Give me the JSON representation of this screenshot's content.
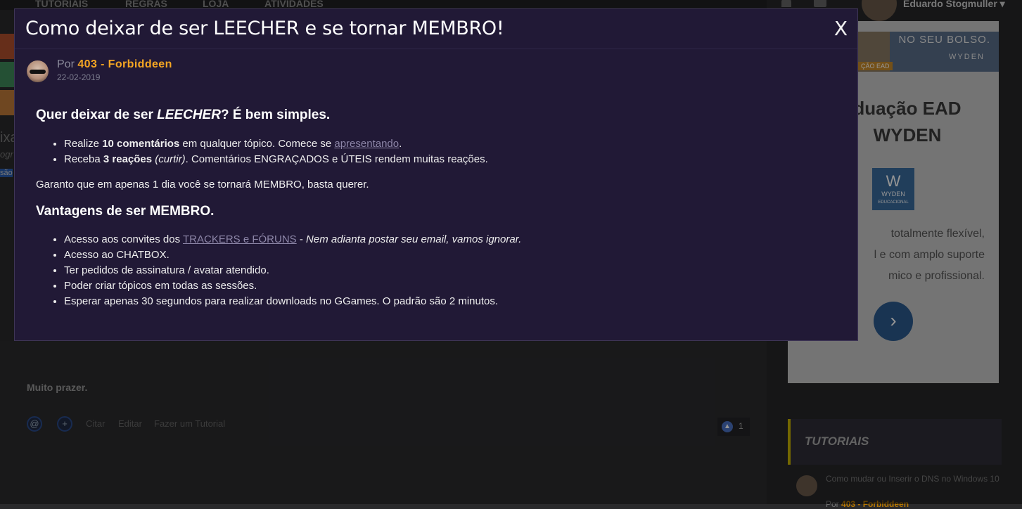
{
  "background": {
    "nav": [
      "TUTORIAIS",
      "REGRAS",
      "LOJA",
      "ATIVIDADES"
    ],
    "user_name": "Eduardo Stogmuller",
    "left_edge": {
      "a": "ixa",
      "b": "ogr",
      "c": "são"
    },
    "ad": {
      "banner_text": "NO SEU BOLSO.",
      "banner_brand": "WYDEN",
      "banner_tag": "ÇÃO EAD",
      "title_line1": "duação EAD",
      "title_line2": "WYDEN",
      "logo_text": "WYDEN",
      "logo_sub": "EDUCACIONAL",
      "text_lines": [
        "totalmente flexível,",
        "l e com amplo suporte",
        "mico e profissional."
      ],
      "arrow": "›"
    },
    "post": {
      "text": "Muito prazer.",
      "actions": [
        "Citar",
        "Editar",
        "Fazer um Tutorial"
      ],
      "reactions_count": "1"
    },
    "sidebar": {
      "section_title": "TUTORIAIS",
      "item_title": "Como mudar ou Inserir o DNS no Windows 10",
      "item_by": "Por",
      "item_author": "403 - Forbiddeen"
    }
  },
  "modal": {
    "title": "Como deixar de ser LEECHER e se tornar MEMBRO!",
    "close_label": "X",
    "by_prefix": "Por",
    "author": "403 - Forbiddeen",
    "date": "22-02-2019",
    "heading1_pre": "Quer deixar de ser ",
    "heading1_em": "LEECHER",
    "heading1_post": "? É bem simples.",
    "list1": [
      {
        "pre": "Realize ",
        "bold": "10 comentários",
        "mid": " em qualquer tópico. Comece se ",
        "link": "apresentando",
        "post": "."
      },
      {
        "pre": "Receba ",
        "bold": "3 reações",
        "em": "(curtir)",
        "post": ". Comentários ENGRAÇADOS e ÚTEIS rendem muitas reações."
      }
    ],
    "para": "Garanto que em apenas 1 dia você se tornará MEMBRO, basta querer.",
    "heading2": "Vantagens de ser MEMBRO.",
    "list2": {
      "item1_pre": "Acesso aos convites dos ",
      "item1_link": "TRACKERS e FÓRUNS",
      "item1_sep": " - ",
      "item1_em": "Nem adianta postar seu email, vamos ignorar.",
      "item2": "Acesso ao CHATBOX.",
      "item3": "Ter pedidos de assinatura / avatar atendido.",
      "item4": "Poder criar tópicos em todas as sessões.",
      "item5": "Esperar apenas 30 segundos para realizar downloads no GGames. O padrão são 2 minutos."
    }
  }
}
